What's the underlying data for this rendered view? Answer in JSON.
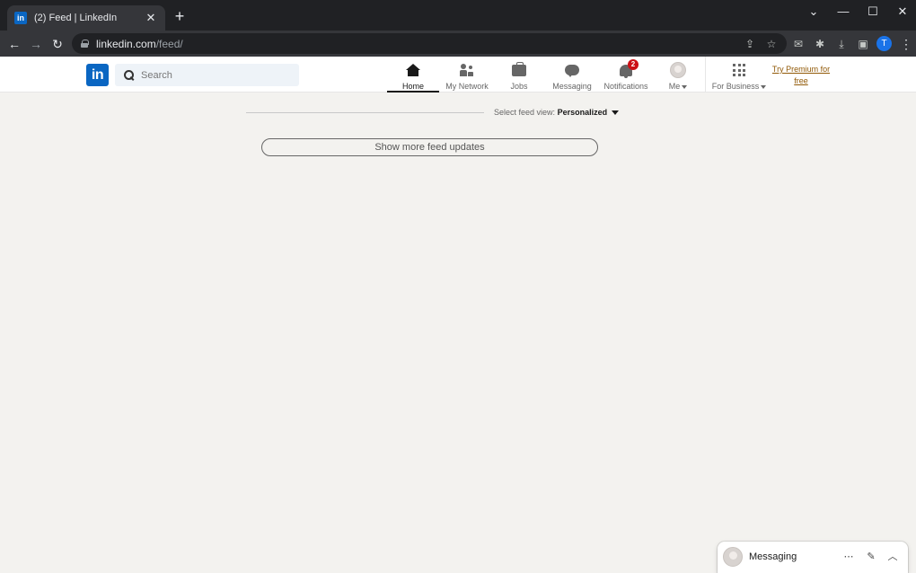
{
  "browser": {
    "tab_title": "(2) Feed | LinkedIn",
    "tab_close": "✕",
    "new_tab": "+",
    "window": {
      "minimize": "—",
      "maximize": "☐",
      "close": "✕",
      "dropdown": "⌄"
    },
    "nav": {
      "back": "←",
      "forward": "→",
      "reload": "↻"
    },
    "url_host": "linkedin.com",
    "url_path": "/feed/",
    "profile_initial": "T",
    "menu": "⋮"
  },
  "linkedin": {
    "logo": "in",
    "search_placeholder": "Search",
    "nav": {
      "home": "Home",
      "network": "My Network",
      "jobs": "Jobs",
      "messaging": "Messaging",
      "notifications": "Notifications",
      "notifications_count": "2",
      "me": "Me",
      "business": "For Business"
    },
    "premium": {
      "line1": "Try Premium for",
      "line2": "free"
    }
  },
  "feed": {
    "sort_label": "Select feed view:",
    "sort_value": "Personalized",
    "show_more": "Show more feed updates"
  },
  "messaging": {
    "title": "Messaging",
    "more": "⋯",
    "compose": "✎",
    "collapse": "︿"
  },
  "colors": {
    "linkedin_blue": "#0a66c2",
    "badge_red": "#cc1016",
    "premium_gold": "#915907",
    "page_bg": "#f3f2ef"
  }
}
